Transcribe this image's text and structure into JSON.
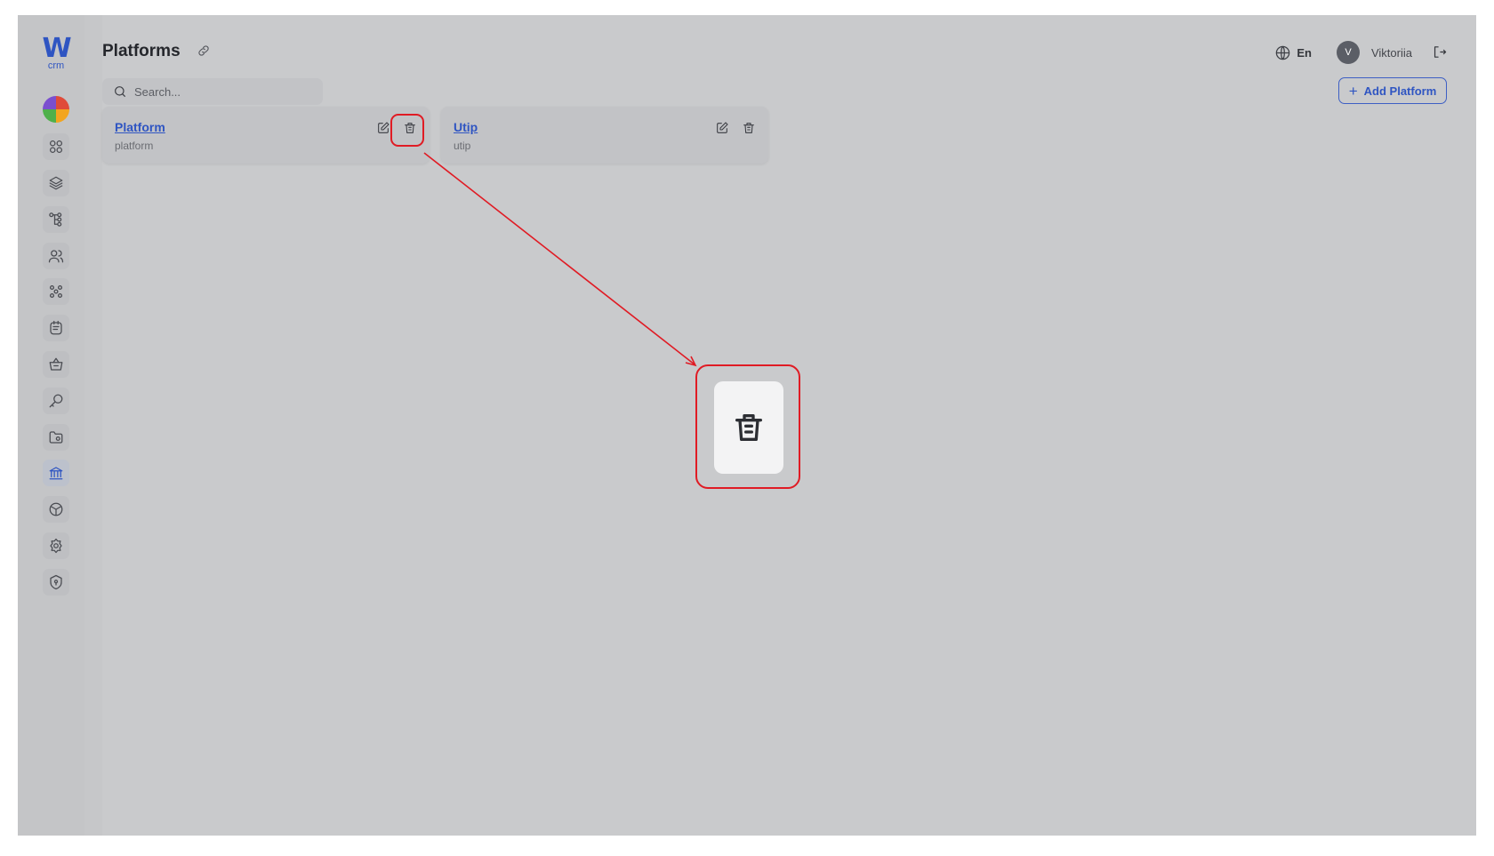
{
  "app": {
    "logo_letter": "W",
    "logo_sub": "crm",
    "brand_color": "#2f55c2"
  },
  "sidebar": {
    "items": [
      {
        "name": "dashboard-icon"
      },
      {
        "name": "layers-icon"
      },
      {
        "name": "hierarchy-icon"
      },
      {
        "name": "users-icon"
      },
      {
        "name": "team-icon"
      },
      {
        "name": "notes-icon"
      },
      {
        "name": "basket-icon"
      },
      {
        "name": "key-icon"
      },
      {
        "name": "folder-icon"
      },
      {
        "name": "bank-icon",
        "active": true
      },
      {
        "name": "box-icon"
      },
      {
        "name": "settings-icon"
      },
      {
        "name": "shield-icon"
      }
    ]
  },
  "header": {
    "title": "Platforms",
    "language": "En",
    "user_initial": "V",
    "user_name": "Viktoriia",
    "add_button": "Add Platform"
  },
  "search": {
    "placeholder": "Search..."
  },
  "platforms": [
    {
      "name": "Platform",
      "slug": "platform"
    },
    {
      "name": "Utip",
      "slug": "utip"
    }
  ],
  "annotation": {
    "color": "#e01b24",
    "target": "delete-icon"
  }
}
